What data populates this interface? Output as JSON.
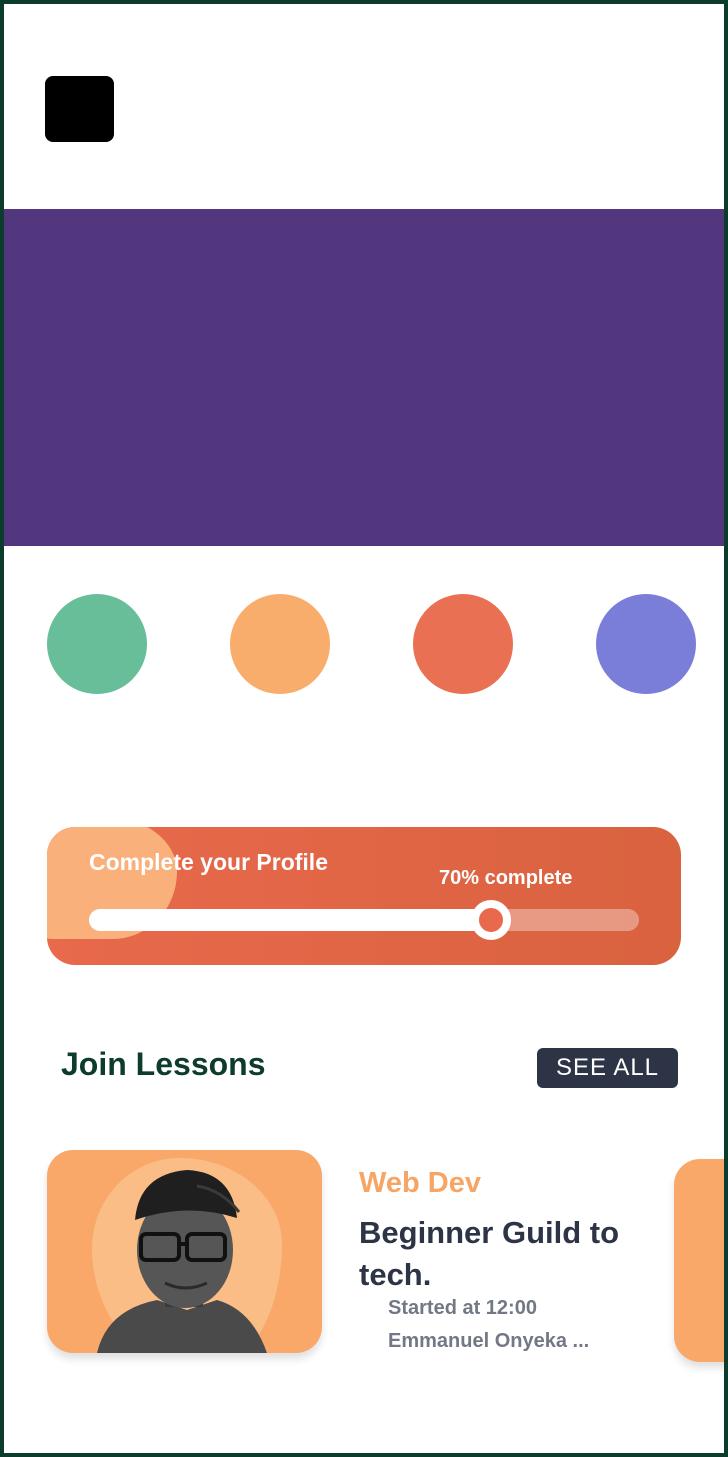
{
  "colors": {
    "banner": "#52377e",
    "category_circles": [
      "#67be98",
      "#f8ad6c",
      "#ea7053",
      "#7b7ed9"
    ],
    "profile_card": "#e8694c",
    "lesson_card": "#f9a869",
    "accent_text": "#f6a565",
    "dark": "#2c3445",
    "heading": "#0d3b2c"
  },
  "profile": {
    "title": "Complete your Profile",
    "progress_label": "70% complete",
    "progress_fraction": 0.73
  },
  "lessons": {
    "section_title": "Join Lessons",
    "see_all_label": "SEE ALL",
    "items": [
      {
        "category": "Web Dev",
        "title": "Beginner Guild to tech.",
        "time": "Started at 12:00",
        "teacher": "Emmanuel Onyeka ...",
        "image_icon": "instructor-photo"
      }
    ]
  }
}
